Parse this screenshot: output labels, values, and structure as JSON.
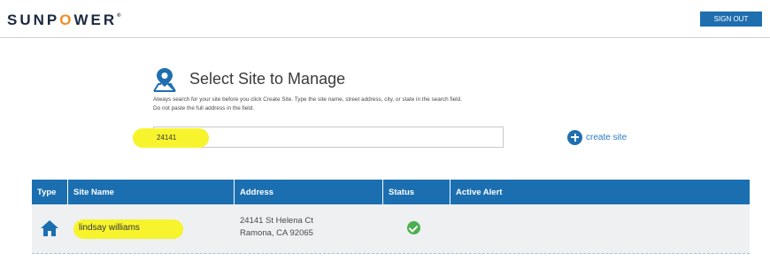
{
  "header": {
    "logo_text": "SUNPOWER",
    "sign_out_label": "SIGN OUT"
  },
  "select_site": {
    "title": "Select Site to Manage",
    "help_text_line1": "Always search for your site before you click Create Site. Type the site name, street address, city, or state in the search field.",
    "help_text_line2": "Do not paste the full address in the field.",
    "search_value": "24141",
    "create_site_label": "create site",
    "icon": "map-pin-icon"
  },
  "table": {
    "columns": [
      "Type",
      "Site Name",
      "Address",
      "Status",
      "Active Alert"
    ],
    "rows": [
      {
        "type_icon": "house-icon",
        "site_name": "lindsay williams",
        "address_line1": "24141 St Helena Ct",
        "address_line2": "Ramona, CA 92065",
        "status_icon": "check-circle-icon",
        "active_alert": ""
      }
    ]
  },
  "colors": {
    "brand_blue": "#1b6fb1",
    "highlight_yellow": "#f7f42e",
    "status_green": "#4caf50",
    "logo_accent": "#f28c28"
  }
}
